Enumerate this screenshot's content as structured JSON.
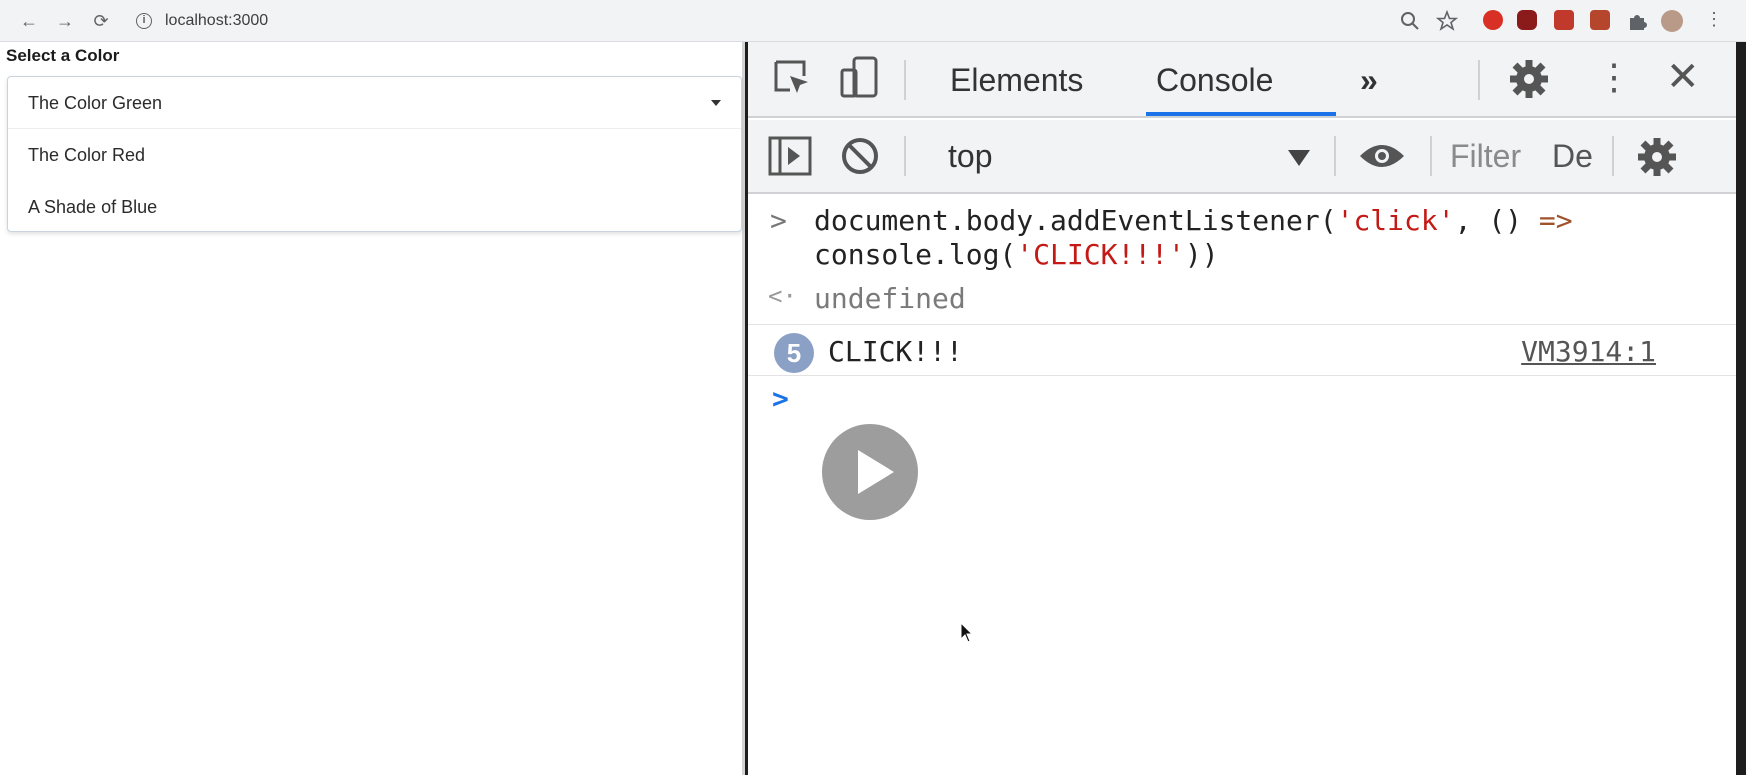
{
  "browser": {
    "url": "localhost:3000",
    "back_icon": "arrow-left-icon",
    "forward_icon": "arrow-right-icon",
    "reload_icon": "reload-icon"
  },
  "page": {
    "label": "Select a Color",
    "select": {
      "selected": "The Color Green",
      "options": [
        "The Color Red",
        "A Shade of Blue"
      ]
    }
  },
  "devtools": {
    "tabs": [
      "Elements",
      "Console"
    ],
    "active_tab": "Console",
    "more_tabs": "»",
    "context": "top",
    "filter_placeholder": "Filter",
    "levels_label": "De",
    "console": {
      "command_line1_a": "document.body.addEventListener(",
      "command_line1_str": "'click'",
      "command_line1_b": ", () ",
      "command_line1_op": "=>",
      "command_line2_a": "console.log(",
      "command_line2_str": "'CLICK!!!'",
      "command_line2_b": "))",
      "result": "undefined",
      "message": {
        "count": "5",
        "text": "CLICK!!!",
        "source": "VM3914:1"
      }
    }
  },
  "colors": {
    "accent": "#1a73e8",
    "string": "#c41a16",
    "badge": "#8aa0c5"
  }
}
